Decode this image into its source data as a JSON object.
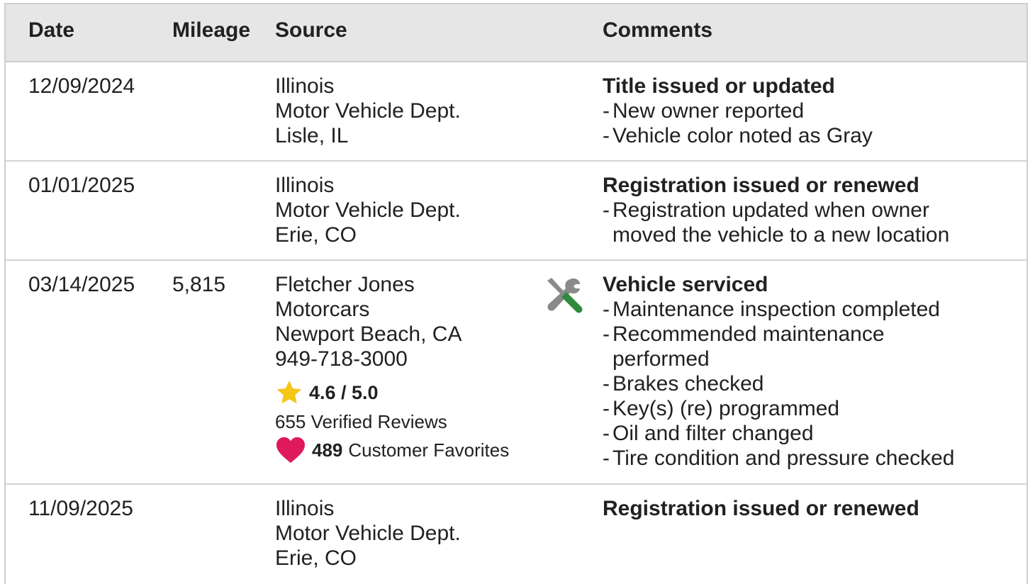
{
  "header": {
    "date": "Date",
    "mileage": "Mileage",
    "source": "Source",
    "comments": "Comments"
  },
  "rows": [
    {
      "date": "12/09/2024",
      "mileage": "",
      "source": [
        "Illinois",
        "Motor Vehicle Dept.",
        "Lisle, IL"
      ],
      "comment_title": "Title issued or updated",
      "comment_items": [
        "New owner reported",
        "Vehicle color noted as Gray"
      ]
    },
    {
      "date": "01/01/2025",
      "mileage": "",
      "source": [
        "Illinois",
        "Motor Vehicle Dept.",
        "Erie, CO"
      ],
      "comment_title": "Registration issued or renewed",
      "comment_items": [
        "Registration updated when owner moved the vehicle to a new location"
      ]
    },
    {
      "date": "03/14/2025",
      "mileage": "5,815",
      "source": [
        "Fletcher Jones",
        "Motorcars",
        "Newport Beach, CA",
        "949-718-3000"
      ],
      "rating": "4.6 / 5.0",
      "reviews": "655 Verified Reviews",
      "favorites_count": "489",
      "favorites_label": "Customer Favorites",
      "icon": "service-tools-icon",
      "comment_title": "Vehicle serviced",
      "comment_items": [
        "Maintenance inspection completed",
        "Recommended maintenance performed",
        "Brakes checked",
        "Key(s) (re) programmed",
        "Oil and filter changed",
        "Tire condition and pressure checked"
      ]
    },
    {
      "date": "11/09/2025",
      "mileage": "",
      "source": [
        "Illinois",
        "Motor Vehicle Dept.",
        "Erie, CO"
      ],
      "comment_title": "Registration issued or renewed",
      "comment_items": []
    }
  ],
  "colors": {
    "star": "#f5c518",
    "heart": "#e0185c",
    "wrench": "#8a8a8a",
    "screwdriver": "#2e8b3d",
    "header_bg": "#e6e6e6"
  }
}
